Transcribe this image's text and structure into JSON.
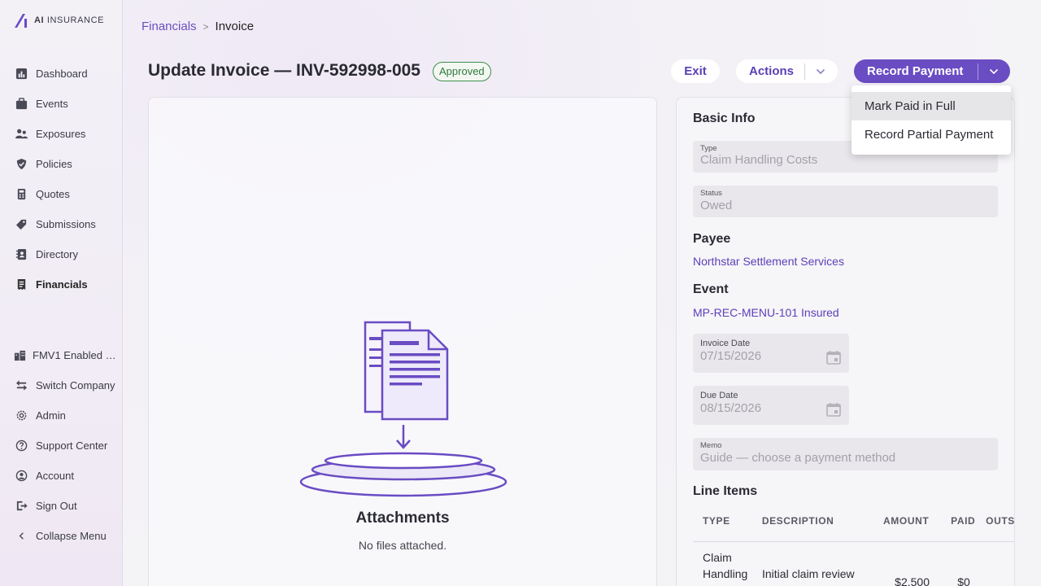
{
  "brand": {
    "name_bold": "AI",
    "name_rest": " INSURANCE"
  },
  "sidebar": {
    "items": [
      {
        "label": "Dashboard",
        "icon": "chart-icon"
      },
      {
        "label": "Events",
        "icon": "briefcase-icon"
      },
      {
        "label": "Exposures",
        "icon": "people-icon"
      },
      {
        "label": "Policies",
        "icon": "shield-icon"
      },
      {
        "label": "Quotes",
        "icon": "calculator-icon"
      },
      {
        "label": "Submissions",
        "icon": "tag-icon"
      },
      {
        "label": "Directory",
        "icon": "address-book-icon"
      },
      {
        "label": "Financials",
        "icon": "receipt-icon",
        "active": true
      }
    ],
    "bottom_items": [
      {
        "label": "FMV1 Enabled …",
        "icon": "building-icon"
      },
      {
        "label": "Switch Company",
        "icon": "switch-icon"
      },
      {
        "label": "Admin",
        "icon": "gear-icon"
      },
      {
        "label": "Support Center",
        "icon": "help-icon"
      },
      {
        "label": "Account",
        "icon": "account-icon"
      },
      {
        "label": "Sign Out",
        "icon": "sign-out-icon"
      },
      {
        "label": "Collapse Menu",
        "icon": "chevron-left-icon"
      }
    ]
  },
  "breadcrumb": {
    "parent": "Financials",
    "separator": ">",
    "current": "Invoice"
  },
  "header": {
    "title": "Update Invoice — INV-592998-005",
    "status": "Approved",
    "exit_label": "Exit",
    "actions_label": "Actions",
    "record_label": "Record Payment"
  },
  "record_menu": {
    "items": [
      "Mark Paid in Full",
      "Record Partial Payment"
    ]
  },
  "attachments": {
    "title": "Attachments",
    "empty": "No files attached."
  },
  "form": {
    "basic_info_title": "Basic Info",
    "type": {
      "label": "Type",
      "value": "Claim Handling Costs"
    },
    "status": {
      "label": "Status",
      "value": "Owed"
    },
    "payee_title": "Payee",
    "payee": "Northstar Settlement Services",
    "event_title": "Event",
    "event": "MP-REC-MENU-101 Insured",
    "invoice_date": {
      "label": "Invoice Date",
      "value": "07/15/2026"
    },
    "due_date": {
      "label": "Due Date",
      "value": "08/15/2026"
    },
    "memo": {
      "label": "Memo",
      "value": "Guide — choose a payment method"
    },
    "line_items_title": "Line Items"
  },
  "line_items": {
    "headers": [
      "TYPE",
      "DESCRIPTION",
      "AMOUNT",
      "PAID",
      "OUTSTA"
    ],
    "rows": [
      {
        "type": "Claim Handling Fees &",
        "description": "Initial claim review",
        "amount": "$2,500",
        "paid": "$0"
      }
    ]
  },
  "colors": {
    "accent": "#6a4cc3",
    "link": "#5d40b8",
    "approved": "#2f7a3c"
  }
}
